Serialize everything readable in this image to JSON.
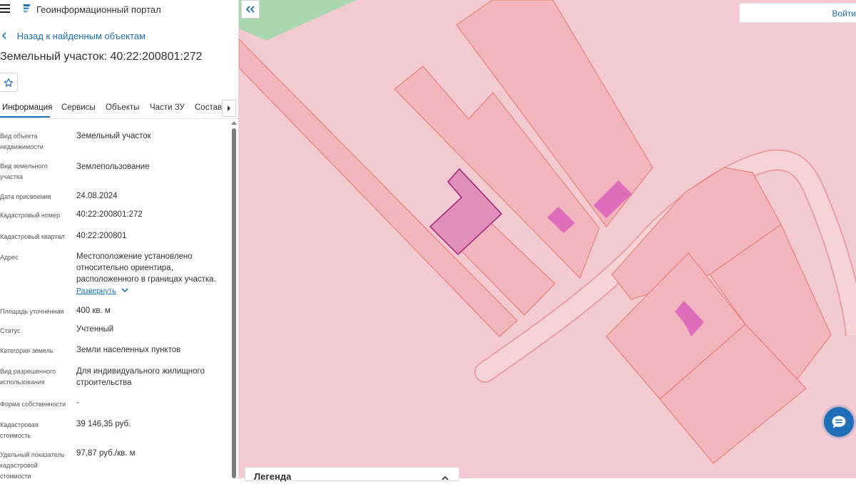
{
  "header": {
    "portal_title": "Геоинформационный портал",
    "back_label": "Назад к найденным объектам",
    "object_title": "Земельный участок: 40:22:200801:272"
  },
  "tabs": [
    {
      "label": "Информация",
      "active": true
    },
    {
      "label": "Сервисы",
      "active": false
    },
    {
      "label": "Объекты",
      "active": false
    },
    {
      "label": "Части ЗУ",
      "active": false
    },
    {
      "label": "Состав",
      "active": false
    }
  ],
  "properties": [
    {
      "label": "Вид объекта недвижимости",
      "value": "Земельный участок"
    },
    {
      "label": "Вид земельного участка",
      "value": "Землепользование"
    },
    {
      "label": "Дата присвоения",
      "value": "24.08.2024"
    },
    {
      "label": "Кадастровый номер",
      "value": "40:22:200801:272"
    },
    {
      "label": "Кадастровый квартал",
      "value": "40:22:200801"
    },
    {
      "label": "Адрес",
      "value": "Местоположение установлено относительно ориентира, расположенного в границах участка.",
      "expand": "Развернуть"
    },
    {
      "label": "Площадь уточненная",
      "value": "400 кв. м"
    },
    {
      "label": "Статус",
      "value": "Учтенный"
    },
    {
      "label": "Категория земель",
      "value": "Земли населенных пунктов"
    },
    {
      "label": "Вид разрешенного использования",
      "value": "Для индивидуального жилищного строительства"
    },
    {
      "label": "Форма собственности",
      "value": "-"
    },
    {
      "label": "Кадастровая стоимость",
      "value": "39 146,35 руб."
    },
    {
      "label": "Удельный показатель кадастровой стоимости",
      "value": "97,87 руб./кв. м"
    }
  ],
  "map": {
    "login_label": "Войти",
    "legend_title": "Легенда",
    "colors": {
      "background": "#f3c9d2",
      "parcel_fill": "#f0b5bd",
      "parcel_stroke": "#e8786c",
      "selected_fill": "#e08fb8",
      "selected_stroke": "#a0207a",
      "building": "#e06cbc",
      "greenery": "#a9d8b0",
      "accent": "#1e6fb8"
    }
  },
  "icons": {
    "menu": "menu-icon",
    "logo": "portal-logo-icon",
    "back": "chevron-left-icon",
    "favorite": "star-icon",
    "tabs_next": "chevron-right-icon",
    "expand": "chevron-down-icon",
    "collapse_panel": "double-chevron-left-icon",
    "legend": "chevron-up-icon",
    "chat": "chat-icon"
  }
}
